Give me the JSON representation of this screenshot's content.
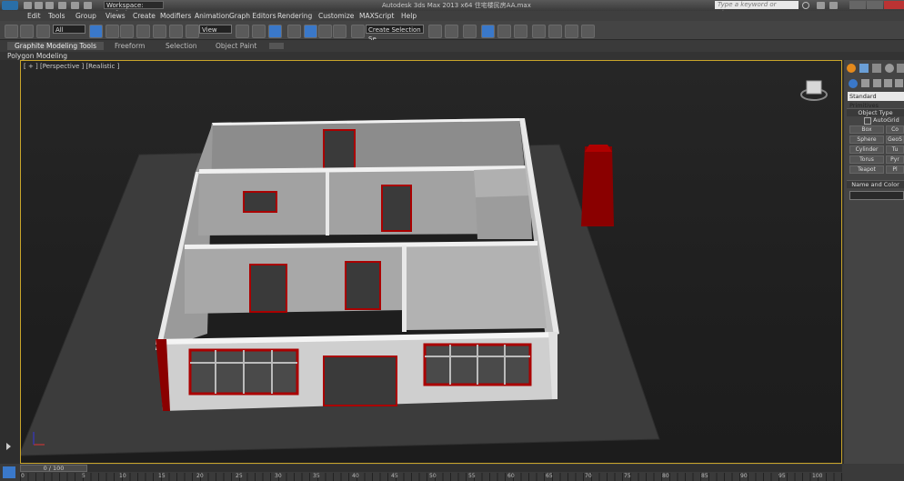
{
  "titlebar": {
    "workspace": "Workspace: Default",
    "title": "Autodesk 3ds Max  2013 x64      住宅楼民房AA.max",
    "search_placeholder": "Type a keyword or phrase"
  },
  "menu": [
    "Edit",
    "Tools",
    "Group",
    "Views",
    "Create",
    "Modifiers",
    "Animation",
    "Graph Editors",
    "Rendering",
    "Customize",
    "MAXScript",
    "Help"
  ],
  "toolbar": {
    "selection_filter": "All",
    "ref_coord": "View",
    "named_selection": "Create Selection Se"
  },
  "ribbon": {
    "tabs": [
      "Graphite Modeling Tools",
      "Freeform",
      "Selection",
      "Object Paint"
    ],
    "subtitle": "Polygon Modeling"
  },
  "viewport": {
    "label": "[ + ] [Perspective ] [Realistic ]",
    "accent_border": "#c9a52a"
  },
  "command_panel": {
    "dropdown": "Standard Primitives",
    "object_type_title": "Object Type",
    "autogrid": "AutoGrid",
    "buttons_left": [
      "Box",
      "Sphere",
      "Cylinder",
      "Torus",
      "Teapot"
    ],
    "buttons_right": [
      "Co",
      "GeoS",
      "Tu",
      "Pyr",
      "Pl"
    ],
    "name_color_title": "Name and Color"
  },
  "timeline": {
    "frame_display": "0 / 100",
    "ticks": [
      "0",
      "5",
      "10",
      "15",
      "20",
      "25",
      "30",
      "35",
      "40",
      "45",
      "50",
      "55",
      "60",
      "65",
      "70",
      "75",
      "80",
      "85",
      "90",
      "95",
      "100"
    ]
  }
}
